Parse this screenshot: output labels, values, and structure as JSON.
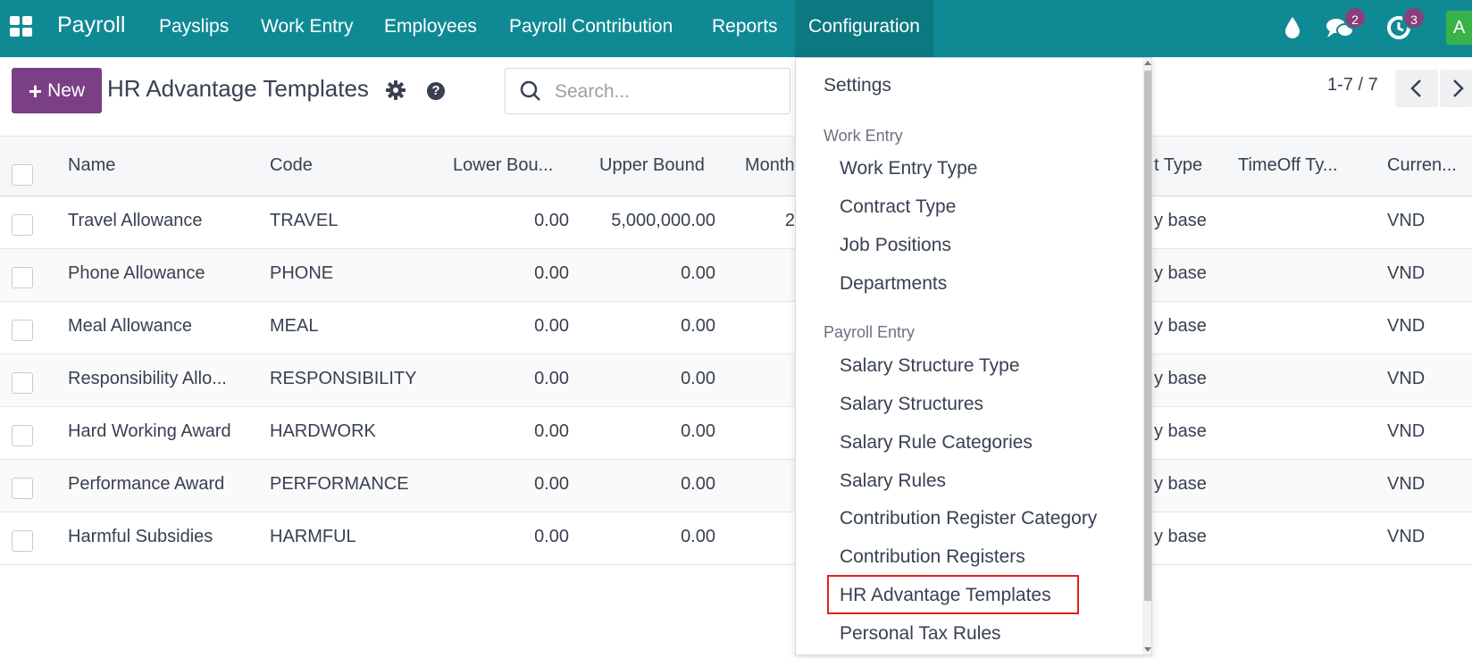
{
  "navbar": {
    "brand": "Payroll",
    "menu": [
      "Payslips",
      "Work Entry",
      "Employees",
      "Payroll Contribution",
      "Reports",
      "Configuration"
    ],
    "messages_count": "2",
    "activities_count": "3",
    "avatar_letter": "A"
  },
  "control": {
    "new_label": "New",
    "title": "HR Advantage Templates",
    "search_placeholder": "Search...",
    "pager": "1-7 / 7"
  },
  "table": {
    "headers": {
      "name": "Name",
      "code": "Code",
      "lower": "Lower Bou...",
      "upper": "Upper Bound",
      "month": "Month",
      "type": "t Type",
      "timeoff": "TimeOff Ty...",
      "currency": "Curren..."
    },
    "rows": [
      {
        "name": "Travel Allowance",
        "code": "TRAVEL",
        "lower": "0.00",
        "upper": "5,000,000.00",
        "month": "2",
        "type": "y base",
        "currency": "VND"
      },
      {
        "name": "Phone Allowance",
        "code": "PHONE",
        "lower": "0.00",
        "upper": "0.00",
        "month": "",
        "type": "y base",
        "currency": "VND"
      },
      {
        "name": "Meal Allowance",
        "code": "MEAL",
        "lower": "0.00",
        "upper": "0.00",
        "month": "",
        "type": "y base",
        "currency": "VND"
      },
      {
        "name": "Responsibility Allo...",
        "code": "RESPONSIBILITY",
        "lower": "0.00",
        "upper": "0.00",
        "month": "",
        "type": "y base",
        "currency": "VND"
      },
      {
        "name": "Hard Working Award",
        "code": "HARDWORK",
        "lower": "0.00",
        "upper": "0.00",
        "month": "",
        "type": "y base",
        "currency": "VND"
      },
      {
        "name": "Performance Award",
        "code": "PERFORMANCE",
        "lower": "0.00",
        "upper": "0.00",
        "month": "",
        "type": "y base",
        "currency": "VND"
      },
      {
        "name": "Harmful Subsidies",
        "code": "HARMFUL",
        "lower": "0.00",
        "upper": "0.00",
        "month": "",
        "type": "y base",
        "currency": "VND"
      }
    ]
  },
  "dropdown": {
    "settings": "Settings",
    "work_entry_header": "Work Entry",
    "work_entry_items": [
      "Work Entry Type",
      "Contract Type",
      "Job Positions",
      "Departments"
    ],
    "payroll_entry_header": "Payroll Entry",
    "payroll_entry_items": [
      "Salary Structure Type",
      "Salary Structures",
      "Salary Rule Categories",
      "Salary Rules",
      "Contribution Register Category",
      "Contribution Registers",
      "HR Advantage Templates",
      "Personal Tax Rules"
    ]
  },
  "colors": {
    "navbar": "#0f8a94",
    "primary_button": "#7b3f86",
    "highlight_border": "#e0201f"
  }
}
